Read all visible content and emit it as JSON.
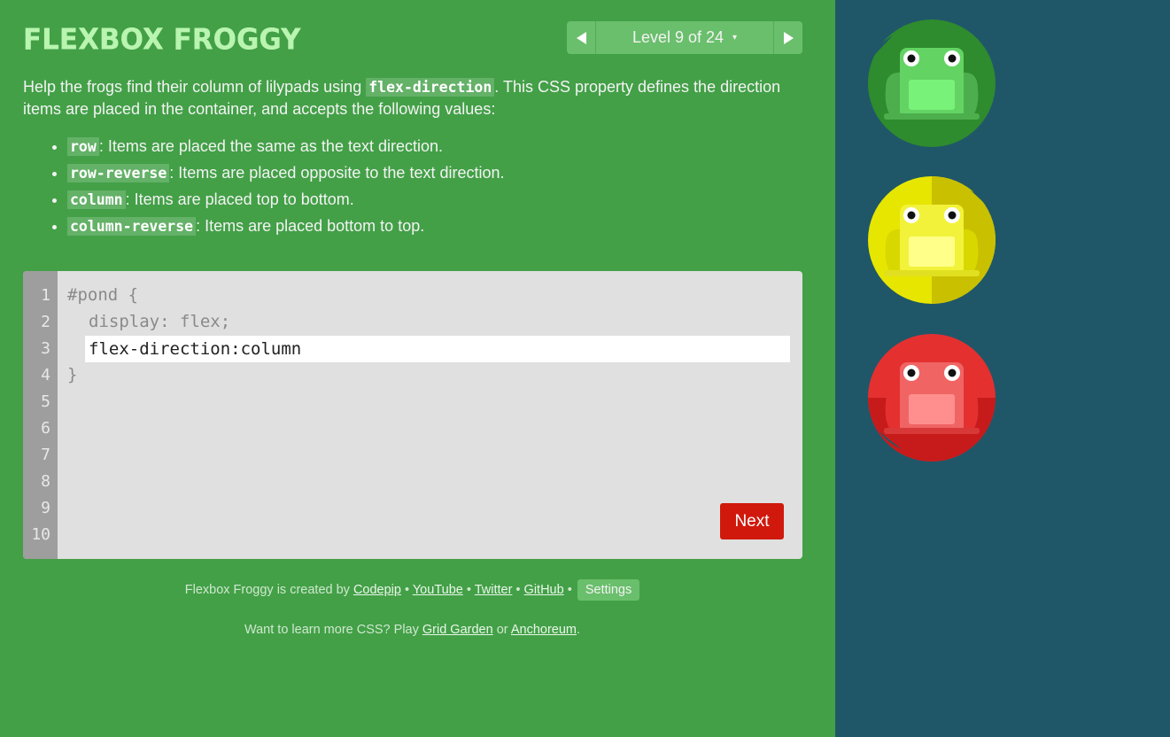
{
  "app": {
    "title": "FLEXBOX FROGGY"
  },
  "level_nav": {
    "label": "Level 9 of 24",
    "caret": "▾",
    "prev_icon": "previous-level-arrow-icon",
    "next_icon": "next-level-arrow-icon"
  },
  "instructions": {
    "intro_before": "Help the frogs find their column of lilypads using ",
    "intro_code": "flex-direction",
    "intro_after": ". This CSS property defines the direction items are placed in the container, and accepts the following values:",
    "values": [
      {
        "code": "row",
        "desc": ": Items are placed the same as the text direction."
      },
      {
        "code": "row-reverse",
        "desc": ": Items are placed opposite to the text direction."
      },
      {
        "code": "column",
        "desc": ": Items are placed top to bottom."
      },
      {
        "code": "column-reverse",
        "desc": ": Items are placed bottom to top."
      }
    ]
  },
  "editor": {
    "line_numbers": [
      "1",
      "2",
      "3",
      "4",
      "5",
      "6",
      "7",
      "8",
      "9",
      "10"
    ],
    "line1": "#pond {",
    "line2": "display: flex;",
    "line4": "}",
    "input_value": "flex-direction:column",
    "next_label": "Next"
  },
  "footer": {
    "created_by": "Flexbox Froggy is created by ",
    "links": [
      "Codepip",
      "YouTube",
      "Twitter",
      "GitHub"
    ],
    "separator": " • ",
    "settings_label": "Settings",
    "learn_before": "Want to learn more CSS? Play ",
    "learn_link1": "Grid Garden",
    "learn_mid": " or ",
    "learn_link2": "Anchoreum",
    "learn_after": "."
  },
  "pond": {
    "frogs": [
      {
        "color": "green",
        "pad": "#2e8b2e",
        "pad_light": "#4cae4c",
        "body": "#63d463",
        "belly": "#79f279"
      },
      {
        "color": "yellow",
        "pad": "#c9c000",
        "pad_light": "#e6e600",
        "body": "#f2f23a",
        "belly": "#ffff8a"
      },
      {
        "color": "red",
        "pad": "#c71b1b",
        "pad_light": "#e53030",
        "body": "#f06464",
        "belly": "#ff8f8f"
      }
    ]
  },
  "colors": {
    "sidebar_bg": "#43a047",
    "pond_bg": "#1f5768",
    "title": "#b9f5b0",
    "next_button": "#d0190c"
  }
}
